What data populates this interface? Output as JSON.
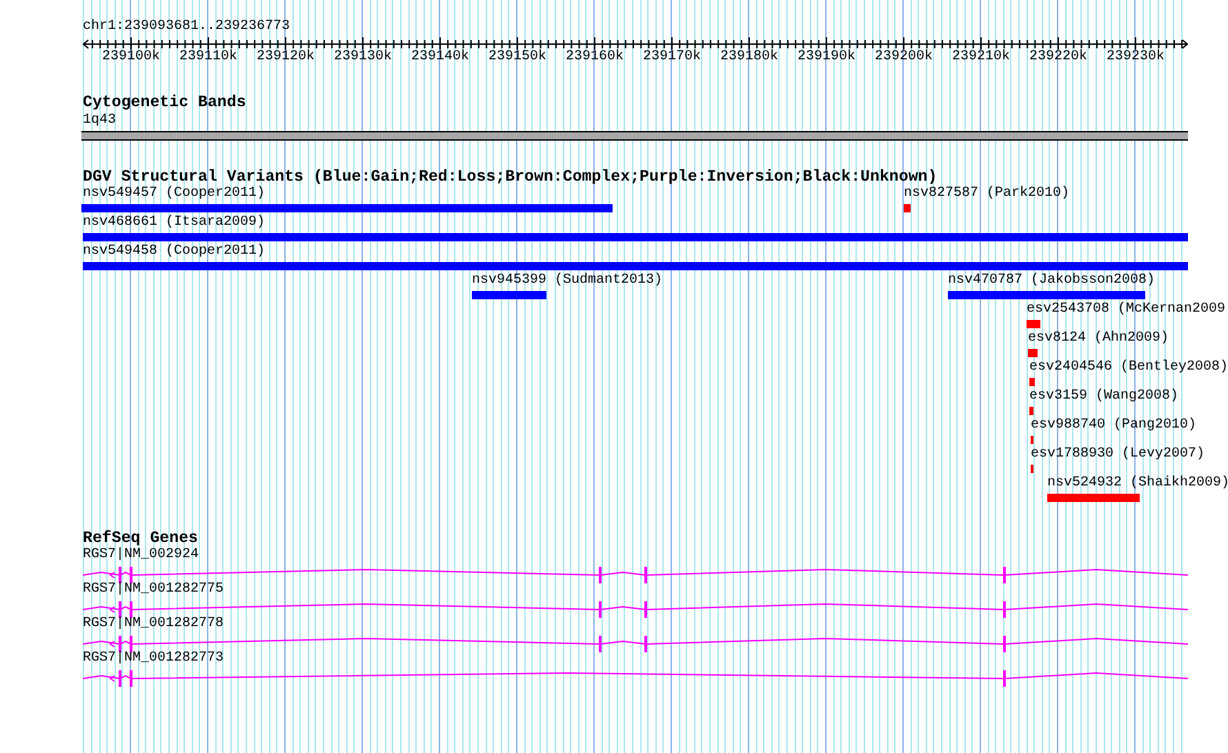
{
  "ruler": {
    "location": "chr1:239093681..239236773",
    "ticks": [
      "239100k",
      "239110k",
      "239120k",
      "239130k",
      "239140k",
      "239150k",
      "239160k",
      "239170k",
      "239180k",
      "239190k",
      "239200k",
      "239210k",
      "239220k",
      "239230k"
    ]
  },
  "tracks": [
    {
      "kind": "cytoband",
      "title": "Cytogenetic Bands",
      "bands": [
        {
          "name": "1q43"
        }
      ]
    },
    {
      "kind": "variants",
      "title": "DGV Structural Variants (Blue:Gain;Red:Loss;Brown:Complex;Purple:Inversion;Black:Unknown)",
      "features": [
        {
          "label": "nsv549457 (Cooper2011)",
          "color": "#0000ff"
        },
        {
          "label": "nsv827587 (Park2010)",
          "color": "#ff0000"
        },
        {
          "label": "nsv468661 (Itsara2009)",
          "color": "#0000ff"
        },
        {
          "label": "nsv549458 (Cooper2011)",
          "color": "#0000ff"
        },
        {
          "label": "nsv945399 (Sudmant2013)",
          "color": "#0000ff"
        },
        {
          "label": "nsv470787 (Jakobsson2008)",
          "color": "#0000ff"
        },
        {
          "label": "esv2543708 (McKernan2009",
          "color": "#ff0000"
        },
        {
          "label": "esv8124 (Ahn2009)",
          "color": "#ff0000"
        },
        {
          "label": "esv2404546 (Bentley2008)",
          "color": "#ff0000"
        },
        {
          "label": "esv3159 (Wang2008)",
          "color": "#ff0000"
        },
        {
          "label": "esv988740 (Pang2010)",
          "color": "#ff0000"
        },
        {
          "label": "esv1788930 (Levy2007)",
          "color": "#ff0000"
        },
        {
          "label": "nsv524932 (Shaikh2009)",
          "color": "#ff0000"
        }
      ]
    },
    {
      "kind": "genes",
      "title": "RefSeq Genes",
      "transcripts": [
        {
          "label": "RGS7|NM_002924"
        },
        {
          "label": "RGS7|NM_001282775"
        },
        {
          "label": "RGS7|NM_001282778"
        },
        {
          "label": "RGS7|NM_001282773"
        }
      ]
    }
  ]
}
